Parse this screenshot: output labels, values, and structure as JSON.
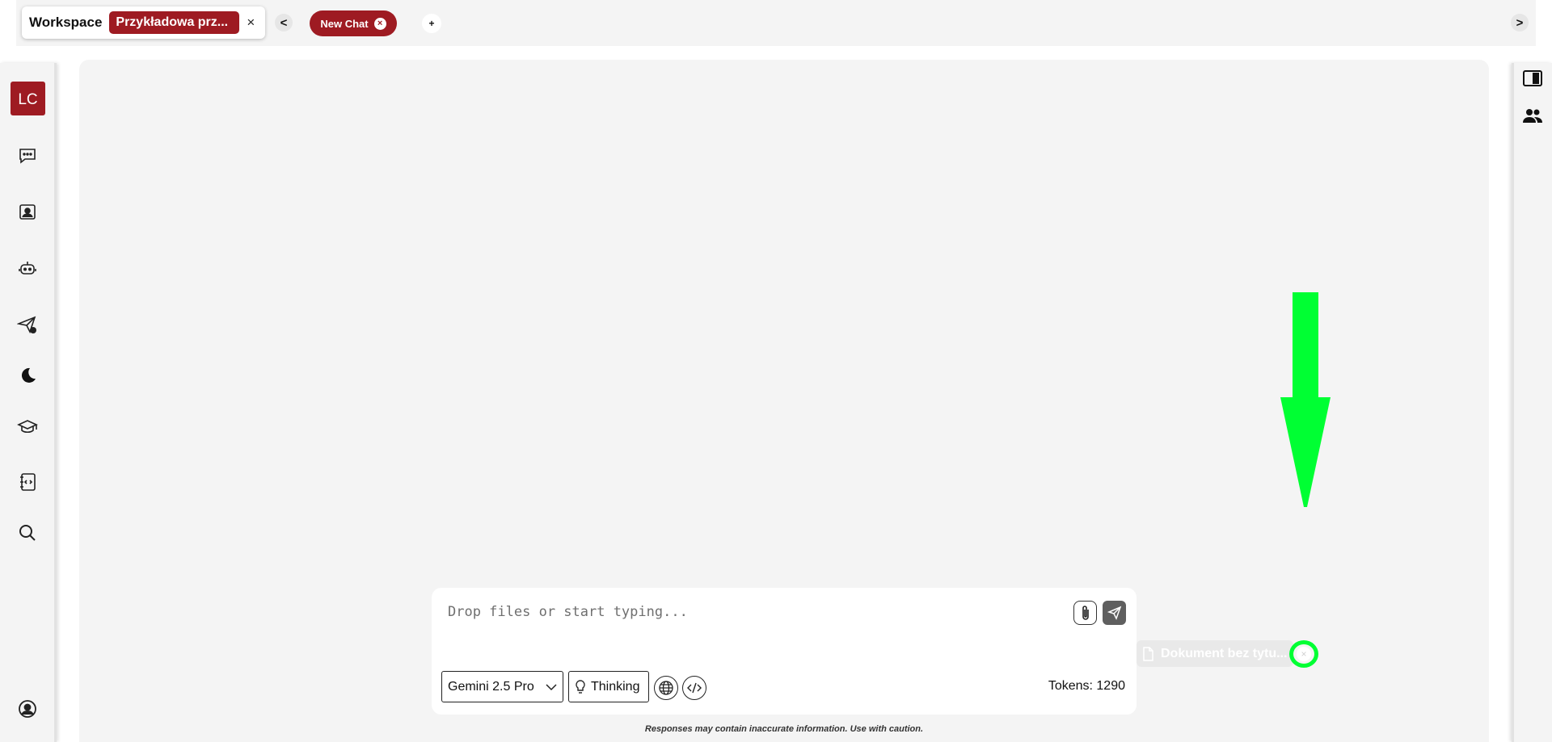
{
  "topbar": {
    "workspace_label": "Workspace",
    "workspace_tag": "Przykładowa prz...",
    "workspace_close": "×",
    "nav_prev": "<",
    "nav_next": ">",
    "chat_tab_label": "New Chat",
    "chat_tab_close": "×",
    "new_tab": "+"
  },
  "sidebar": {
    "avatar_initials": "LC",
    "icons": [
      "chat-icon",
      "contact-card-icon",
      "robot-icon",
      "send-icon",
      "moon-icon",
      "graduation-cap-icon",
      "code-notebook-icon",
      "search-icon",
      "user-circle-icon"
    ]
  },
  "right_sidebar": {
    "icons": [
      "panel-toggle-icon",
      "users-icon"
    ]
  },
  "composer": {
    "placeholder": "Drop files or start typing...",
    "model": "Gemini 2.5 Pro",
    "thinking_label": "Thinking",
    "tokens_label": "Tokens: 1290"
  },
  "disclaimer": "Responses may contain inaccurate information. Use with caution.",
  "document_chip": {
    "label": "Dokument bez tytu...",
    "close": "×"
  },
  "colors": {
    "accent": "#9e1b22",
    "annotation": "#00ff33",
    "panel_bg": "#f4f4f4"
  }
}
